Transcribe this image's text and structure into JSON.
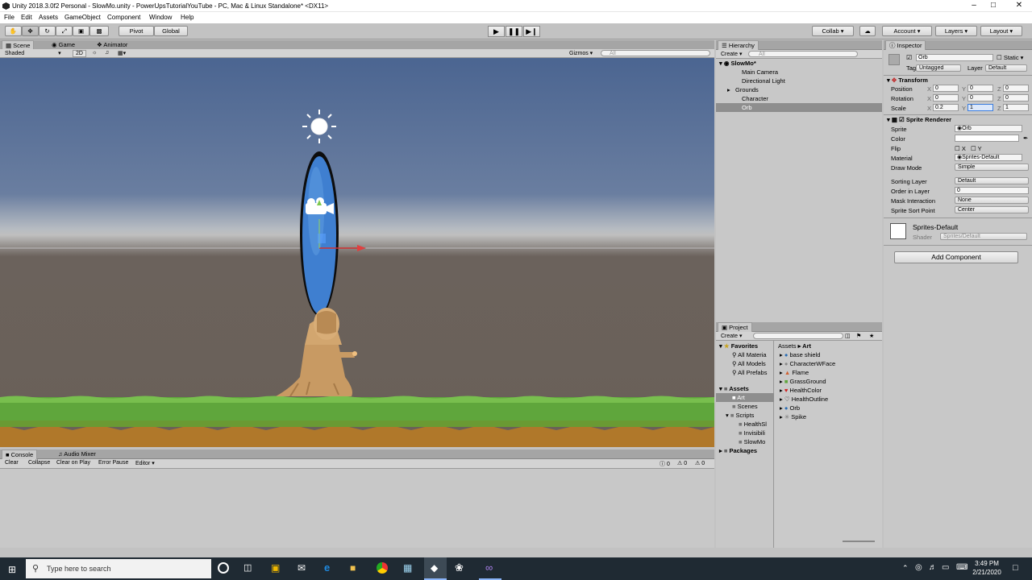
{
  "window": {
    "title": "Unity 2018.3.0f2 Personal - SlowMo.unity - PowerUpsTutorialYouTube - PC, Mac & Linux Standalone* <DX11>"
  },
  "menu": [
    "File",
    "Edit",
    "Assets",
    "GameObject",
    "Component",
    "Window",
    "Help"
  ],
  "toolbar": {
    "pivot": "Pivot",
    "global": "Global",
    "collab": "Collab",
    "account": "Account",
    "layers": "Layers",
    "layout": "Layout"
  },
  "scene_tabs": {
    "scene": "Scene",
    "game": "Game",
    "animator": "Animator",
    "shaded": "Shaded",
    "mode2d": "2D",
    "gizmos": "Gizmos",
    "search_placeholder": "All"
  },
  "console": {
    "tab": "Console",
    "tab2": "Audio Mixer",
    "clear": "Clear",
    "collapse": "Collapse",
    "clear_on_play": "Clear on Play",
    "error_pause": "Error Pause",
    "editor": "Editor",
    "count_log": "0",
    "count_warn": "0",
    "count_err": "0"
  },
  "hierarchy": {
    "tab": "Hierarchy",
    "create": "Create",
    "search_placeholder": "All",
    "scene": "SlowMo*",
    "items": [
      "Main Camera",
      "Directional Light",
      "Grounds",
      "Character",
      "Orb"
    ]
  },
  "project": {
    "tab": "Project",
    "create": "Create",
    "favorites": "Favorites",
    "fav_items": [
      "All Materia",
      "All Models",
      "All Prefabs"
    ],
    "assets": "Assets",
    "asset_folders": [
      "Art",
      "Scenes",
      "Scripts"
    ],
    "script_folders": [
      "HealthSl",
      "Invisibili",
      "SlowMo"
    ],
    "packages": "Packages",
    "breadcrumb": [
      "Assets",
      "Art"
    ],
    "files": [
      "base shield",
      "CharacterWFace",
      "Flame",
      "GrassGround",
      "HealthColor",
      "HealthOutline",
      "Orb",
      "Spike"
    ]
  },
  "inspector": {
    "tab": "Inspector",
    "name": "Orb",
    "static": "Static",
    "tag_label": "Tag",
    "tag": "Untagged",
    "layer_label": "Layer",
    "layer": "Default",
    "transform": "Transform",
    "position_label": "Position",
    "rotation_label": "Rotation",
    "scale_label": "Scale",
    "position": [
      "0",
      "0",
      "0"
    ],
    "rotation": [
      "0",
      "0",
      "0"
    ],
    "scale": [
      "0.2",
      "1",
      "1"
    ],
    "axis": [
      "X",
      "Y",
      "Z"
    ],
    "sprite_renderer": "Sprite Renderer",
    "sprite_label": "Sprite",
    "sprite": "Orb",
    "color_label": "Color",
    "flip_label": "Flip",
    "flip_x": "X",
    "flip_y": "Y",
    "material_label": "Material",
    "material": "Sprites-Default",
    "draw_mode_label": "Draw Mode",
    "draw_mode": "Simple",
    "sorting_layer_label": "Sorting Layer",
    "sorting_layer": "Default",
    "order_label": "Order in Layer",
    "order": "0",
    "mask_label": "Mask Interaction",
    "mask": "None",
    "sort_point_label": "Sprite Sort Point",
    "sort_point": "Center",
    "mat_name": "Sprites-Default",
    "shader_label": "Shader",
    "shader": "Sprites/Default",
    "add_component": "Add Component"
  },
  "taskbar": {
    "search_placeholder": "Type here to search",
    "time": "3:49 PM",
    "date": "2/21/2020"
  },
  "colors": {
    "scene_sky": "#4b6591",
    "grass": "#5fa63c",
    "dirt": "#b0782a",
    "orb": "#3f7fd0",
    "selection": "#8e8e8e",
    "taskbar": "#1f2a33"
  }
}
